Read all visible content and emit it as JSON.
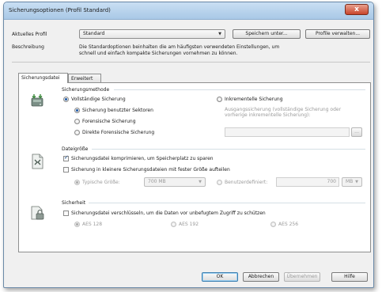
{
  "window": {
    "title": "Sicherungsoptionen (Profil Standard)",
    "close_glyph": "x"
  },
  "profile": {
    "label": "Aktuelles Profil",
    "selected": "Standard",
    "save_label": "Speichern unter...",
    "manage_label": "Profile verwalten..."
  },
  "description": {
    "label": "Beschreibung",
    "text_line1": "Die Standardoptionen beinhalten die am häufigsten verwendeten Einstellungen, um",
    "text_line2": "schnell und einfach kompakte Sicherungen vornehmen zu können."
  },
  "tabs": [
    {
      "label": "Sicherungsdatei",
      "active": true
    },
    {
      "label": "Erweitert",
      "active": false
    }
  ],
  "method": {
    "title": "Sicherungsmethode",
    "full": "Vollständige Sicherung",
    "used_sectors": "Sicherung benutzter Sektoren",
    "forensic": "Forensische Sicherung",
    "direct_forensic": "Direkte Forensische Sicherung",
    "incremental": "Inkrementelle Sicherung",
    "source_hint_line1": "Ausgangssicherung (vollständige Sicherung oder",
    "source_hint_line2": "vorherige inkrementelle Sicherung):",
    "browse_label": "..."
  },
  "filesize": {
    "title": "Dateigröße",
    "compress": "Sicherungsdatei komprimieren, um Speicherplatz zu sparen",
    "split": "Sicherung in kleinere Sicherungsdateien mit fester Größe aufteilen",
    "typical_label": "Typische Größe:",
    "typical_value": "700 MB",
    "custom_label": "Benutzerdefiniert:",
    "custom_value": "700",
    "unit_value": "MB"
  },
  "security": {
    "title": "Sicherheit",
    "encrypt": "Sicherungsdatei verschlüsseln, um die Daten vor unbefugtem Zugriff zu schützen",
    "aes128": "AES 128",
    "aes192": "AES 192",
    "aes256": "AES 256"
  },
  "footer": {
    "ok": "OK",
    "cancel": "Abbrechen",
    "apply": "Übernehmen",
    "help": "Hilfe"
  },
  "icons": {
    "method": "disk-arrow-icon",
    "filesize": "file-compress-icon",
    "security": "lock-document-icon"
  }
}
